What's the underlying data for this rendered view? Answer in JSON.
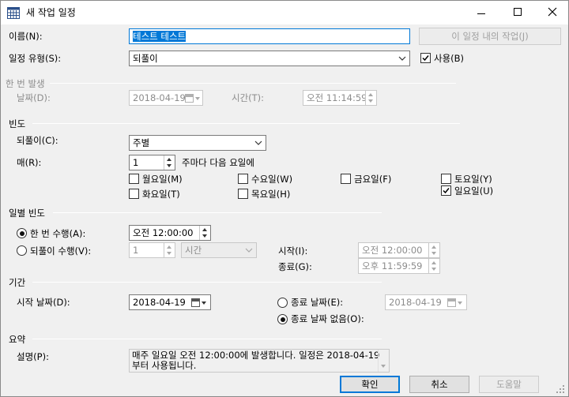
{
  "window": {
    "title": "새 작업 일정"
  },
  "name": {
    "label": "이름(N):",
    "value": "테스트 테스트",
    "tasks_button": "이 일정 내의 작업(J)"
  },
  "schedule_type": {
    "label": "일정 유형(S):",
    "value": "되풀이",
    "enable_label": "사용(B)",
    "enabled": true
  },
  "onetime": {
    "header": "한 번 발생",
    "date_label": "날짜(D):",
    "date_value": "2018-04-19",
    "time_label": "시간(T):",
    "time_value": "오전 11:14:59"
  },
  "frequency": {
    "header": "빈도",
    "recurs_label": "되풀이(C):",
    "recurs_value": "주별",
    "every_label": "매(R):",
    "every_value": "1",
    "every_suffix": "주마다 다음 요일에",
    "days": [
      {
        "label": "월요일(M)",
        "checked": false
      },
      {
        "label": "수요일(W)",
        "checked": false
      },
      {
        "label": "금요일(F)",
        "checked": false
      },
      {
        "label": "토요일(Y)",
        "checked": false
      },
      {
        "label": "화요일(T)",
        "checked": false
      },
      {
        "label": "목요일(H)",
        "checked": false
      },
      {
        "label": "일요일(U)",
        "checked": true
      }
    ]
  },
  "daily": {
    "header": "일별 빈도",
    "once_label": "한 번 수행(A):",
    "once_selected": true,
    "once_time": "오전 12:00:00",
    "recurring_label": "되풀이 수행(V):",
    "recurring_value": "1",
    "recurring_unit": "시간",
    "start_label": "시작(I):",
    "start_value": "오전 12:00:00",
    "end_label": "종료(G):",
    "end_value": "오후 11:59:59"
  },
  "duration": {
    "header": "기간",
    "start_label": "시작 날짜(D):",
    "start_value": "2018-04-19",
    "end_date_label": "종료 날짜(E):",
    "end_date_value": "2018-04-19",
    "no_end_label": "종료 날짜 없음(O):",
    "no_end_selected": true
  },
  "summary": {
    "header": "요약",
    "desc_label": "설명(P):",
    "desc_line1": "매주 일요일 오전 12:00:00에 발생합니다. 일정은 2018-04-19",
    "desc_line2": "부터 사용됩니다."
  },
  "buttons": {
    "ok": "확인",
    "cancel": "취소",
    "help": "도움말"
  },
  "colors": {
    "accent": "#0078d7",
    "window_bg": "#f0f0f0"
  }
}
